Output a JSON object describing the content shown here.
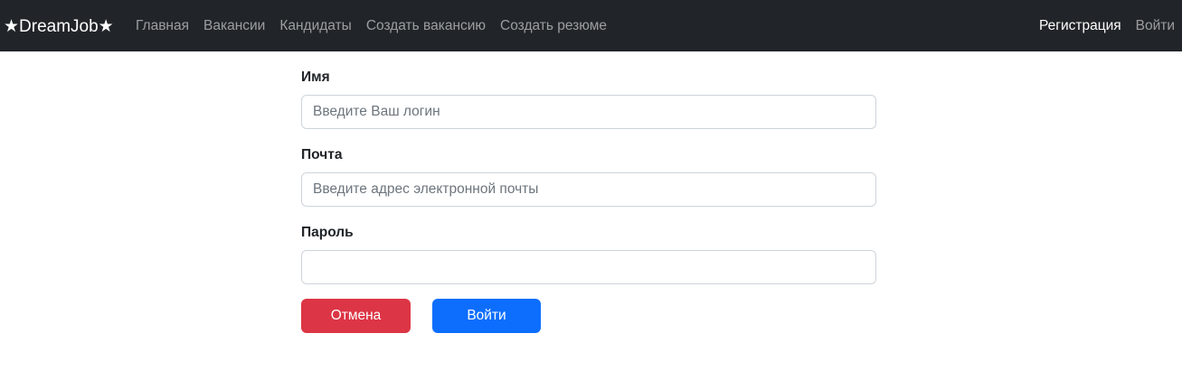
{
  "navbar": {
    "brand": "★DreamJob★",
    "links": [
      {
        "label": "Главная"
      },
      {
        "label": "Вакансии"
      },
      {
        "label": "Кандидаты"
      },
      {
        "label": "Создать вакансию"
      },
      {
        "label": "Создать резюме"
      }
    ],
    "register_label": "Регистрация",
    "login_label": "Войти"
  },
  "form": {
    "name": {
      "label": "Имя",
      "placeholder": "Введите Ваш логин",
      "value": ""
    },
    "email": {
      "label": "Почта",
      "placeholder": "Введите адрес электронной почты",
      "value": ""
    },
    "password": {
      "label": "Пароль",
      "placeholder": "",
      "value": ""
    },
    "cancel_label": "Отмена",
    "submit_label": "Войти"
  },
  "colors": {
    "navbar_bg": "#212529",
    "cancel_button": "#dc3545",
    "submit_button": "#0d6efd"
  }
}
